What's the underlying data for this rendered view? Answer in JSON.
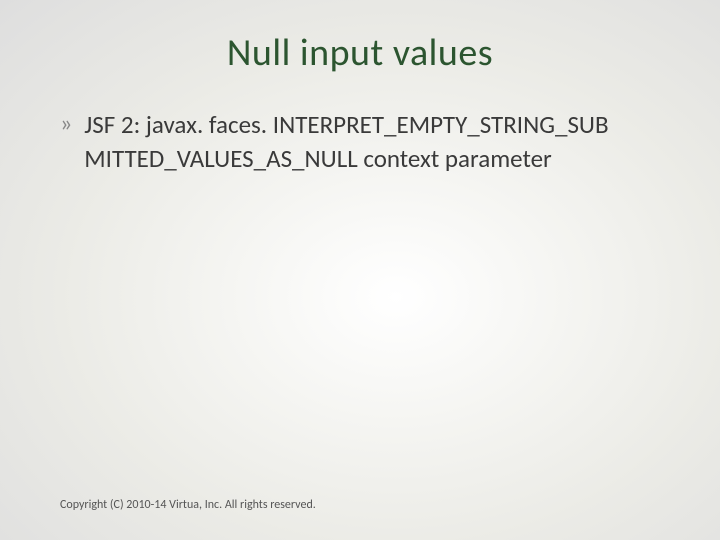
{
  "slide": {
    "title": "Null input values",
    "bullet": {
      "marker": "»",
      "text": "JSF 2: javax. faces. INTERPRET_EMPTY_STRING_SUB MITTED_VALUES_AS_NULL context parameter"
    },
    "footer": "Copyright (C) 2010-14 Virtua, Inc. All rights reserved."
  }
}
